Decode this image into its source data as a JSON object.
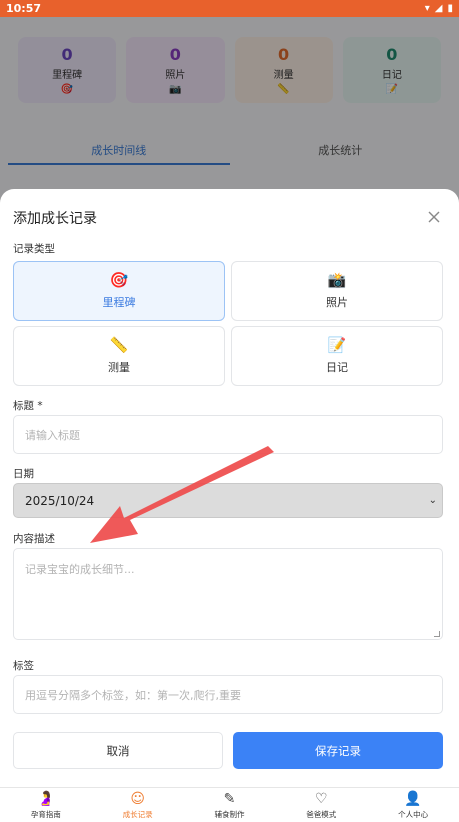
{
  "status_bar": {
    "time": "10:57"
  },
  "background": {
    "stats": [
      {
        "count": "0",
        "label": "里程碑",
        "color": "#6b46c1",
        "bg": "#ede7f8"
      },
      {
        "count": "0",
        "label": "照片",
        "color": "#8a3cc2",
        "bg": "#f3e6f8"
      },
      {
        "count": "0",
        "label": "测量",
        "color": "#e06b2d",
        "bg": "#fbeee4"
      },
      {
        "count": "0",
        "label": "日记",
        "color": "#1f8a6e",
        "bg": "#e6f4f0"
      }
    ],
    "tabs": [
      {
        "label": "成长时间线",
        "active": true
      },
      {
        "label": "成长统计",
        "active": false
      }
    ]
  },
  "sheet": {
    "title": "添加成长记录",
    "record_type_label": "记录类型",
    "record_types": [
      {
        "label": "里程碑",
        "icon": "target-icon",
        "selected": true
      },
      {
        "label": "照片",
        "icon": "camera-icon",
        "selected": false
      },
      {
        "label": "测量",
        "icon": "ruler-icon",
        "selected": false
      },
      {
        "label": "日记",
        "icon": "notebook-icon",
        "selected": false
      }
    ],
    "title_field": {
      "label": "标题 *",
      "placeholder": "请输入标题"
    },
    "date_field": {
      "label": "日期",
      "value": "2025/10/24"
    },
    "description_field": {
      "label": "内容描述",
      "placeholder": "记录宝宝的成长细节..."
    },
    "tags_field": {
      "label": "标签",
      "placeholder": "用逗号分隔多个标签，如：第一次,爬行,重要"
    },
    "cancel_label": "取消",
    "save_label": "保存记录"
  },
  "bottom_nav": [
    {
      "label": "孕育指南",
      "icon": "guide-icon",
      "active": false
    },
    {
      "label": "成长记录",
      "icon": "baby-face-icon",
      "active": true
    },
    {
      "label": "辅食制作",
      "icon": "pen-icon",
      "active": false
    },
    {
      "label": "爸爸模式",
      "icon": "heart-chat-icon",
      "active": false
    },
    {
      "label": "个人中心",
      "icon": "person-icon",
      "active": false
    }
  ],
  "colors": {
    "accent": "#3b82f6",
    "status_bar": "#e8612c",
    "nav_active": "#ef7d31"
  }
}
